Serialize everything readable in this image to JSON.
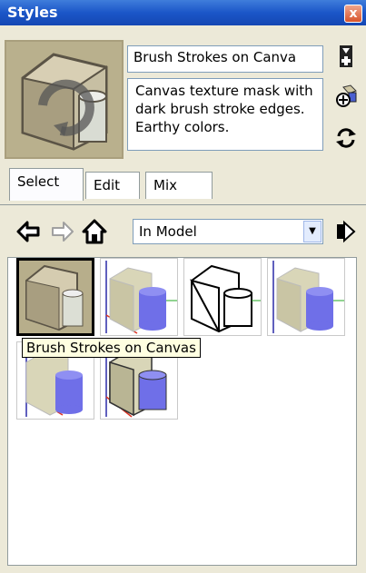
{
  "window": {
    "title": "Styles",
    "close_label": "x"
  },
  "style": {
    "name": "Brush Strokes on Canva",
    "description": "Canvas texture mask with dark brush stroke edges.  Earthy colors."
  },
  "side_icons": [
    "create-new-style-icon",
    "update-style-icon",
    "refresh-icon"
  ],
  "tabs": [
    {
      "label": "Select",
      "active": true
    },
    {
      "label": "Edit",
      "active": false
    },
    {
      "label": "Mix",
      "active": false
    }
  ],
  "nav": {
    "back_icon": "back-arrow-icon",
    "forward_icon": "forward-arrow-icon",
    "home_icon": "home-icon",
    "collection": "In Model",
    "details_icon": "details-arrow-icon"
  },
  "tooltip": "Brush Strokes on Canvas",
  "thumbnails": [
    {
      "name": "Brush Strokes on Canvas",
      "selected": true
    },
    {
      "name": "style-2",
      "selected": false
    },
    {
      "name": "style-3",
      "selected": false
    },
    {
      "name": "style-4",
      "selected": false
    },
    {
      "name": "style-5",
      "selected": false
    },
    {
      "name": "style-6",
      "selected": false
    }
  ],
  "colors": {
    "titlebar": "#1b56c8",
    "panel": "#ece9d8",
    "cylinder_blue": "#6f6fe8",
    "box_beige": "#d9d6b8"
  }
}
